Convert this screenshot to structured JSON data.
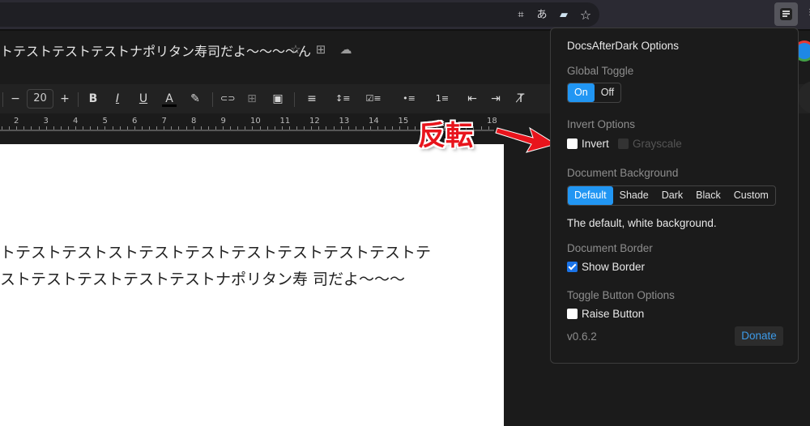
{
  "browser": {
    "omnibox_icons": [
      "qr-code-icon",
      "translate-icon",
      "reader-mode-icon",
      "bookmark-star-icon"
    ],
    "extension_icon": "docs-after-dark-icon",
    "menu_glyph": "⋮"
  },
  "doc": {
    "title": "トテストテストテストナポリタン寿司だよ〜〜〜〜ん",
    "title_icons": [
      "star-icon",
      "move-folder-icon",
      "cloud-saved-icon"
    ],
    "body_lines": [
      "トテストテストストテストテストテストテストテストテストテ",
      "ストテストテストテストテストナポリタン寿 司だよ〜〜〜"
    ]
  },
  "toolbar": {
    "font_size": "20",
    "minus": "−",
    "plus": "+",
    "bold": "B",
    "italic": "I",
    "underline": "U",
    "text_color": "A",
    "highlight": "✎",
    "link": "⊂⊃",
    "comment": "⊞",
    "image": "▣",
    "align": "≡",
    "line_spacing": "↕≡",
    "checklist": "☑≡",
    "bullets": "•≡",
    "numbered": "1≡",
    "indent_decrease": "⇤",
    "indent_increase": "⇥",
    "clear_format": "T̸"
  },
  "ruler": {
    "numbers": [
      "2",
      "3",
      "4",
      "5",
      "6",
      "7",
      "8",
      "9",
      "10",
      "11",
      "12",
      "13",
      "14",
      "15",
      "18"
    ]
  },
  "annotation": {
    "text": "反転",
    "color": "#e8141c"
  },
  "popup": {
    "title": "DocsAfterDark Options",
    "global_toggle": {
      "label": "Global Toggle",
      "options": [
        "On",
        "Off"
      ],
      "selected": "On"
    },
    "invert_options": {
      "label": "Invert Options",
      "invert": {
        "label": "Invert",
        "checked": false
      },
      "grayscale": {
        "label": "Grayscale",
        "checked": false,
        "disabled": true
      }
    },
    "document_background": {
      "label": "Document Background",
      "options": [
        "Default",
        "Shade",
        "Dark",
        "Black",
        "Custom"
      ],
      "selected": "Default",
      "description": "The default, white background."
    },
    "document_border": {
      "label": "Document Border",
      "show_border": {
        "label": "Show Border",
        "checked": true
      }
    },
    "toggle_button_options": {
      "label": "Toggle Button Options",
      "raise_button": {
        "label": "Raise Button",
        "checked": false
      }
    },
    "version": "v0.6.2",
    "donate_label": "Donate",
    "accent_color": "#2196f3"
  }
}
